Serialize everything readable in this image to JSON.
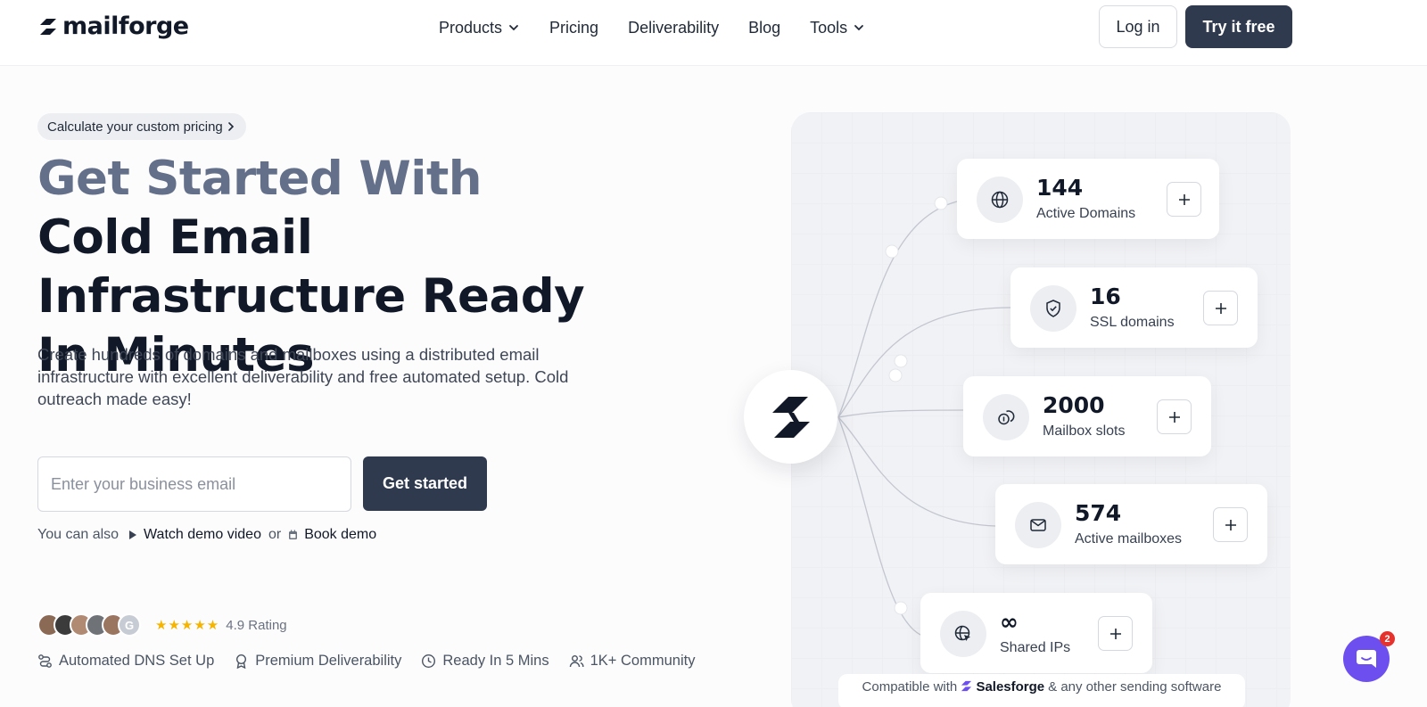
{
  "brand": {
    "name": "mailforge"
  },
  "nav": {
    "links": [
      {
        "label": "Products",
        "has_dropdown": true
      },
      {
        "label": "Pricing"
      },
      {
        "label": "Deliverability"
      },
      {
        "label": "Blog"
      },
      {
        "label": "Tools",
        "has_dropdown": true
      }
    ],
    "login_label": "Log in",
    "try_label": "Try it free"
  },
  "hero": {
    "pill_label": "Calculate your custom pricing",
    "headline_muted": "Get Started With",
    "headline_rest": "Cold Email Infrastructure Ready In Minutes",
    "subtitle": "Create hundreds of domains and mailboxes using a distributed email infrastructure with excellent deliverability and free automated setup. Cold outreach made easy!",
    "email_placeholder": "Enter your business email",
    "cta_label": "Get started",
    "also_prefix": "You can also",
    "watch_label": "Watch demo video",
    "or_text": "or",
    "book_label": "Book demo",
    "stars": "★★★★★",
    "rating_text": "4.9 Rating",
    "features": [
      {
        "label": "Automated DNS Set Up",
        "icon": "dns-route-icon"
      },
      {
        "label": "Premium Deliverability",
        "icon": "award-icon"
      },
      {
        "label": "Ready In 5 Mins",
        "icon": "clock-icon"
      },
      {
        "label": "1K+ Community",
        "icon": "users-icon"
      }
    ]
  },
  "stats": [
    {
      "value": "144",
      "label": "Active Domains",
      "icon": "globe-icon"
    },
    {
      "value": "16",
      "label": "SSL domains",
      "icon": "shield-check-icon"
    },
    {
      "value": "2000",
      "label": "Mailbox slots",
      "icon": "coins-icon"
    },
    {
      "value": "574",
      "label": "Active mailboxes",
      "icon": "mail-icon"
    },
    {
      "value": "∞",
      "label": "Shared IPs",
      "icon": "globe-pointer-icon"
    }
  ],
  "compat": {
    "prefix": "Compatible with",
    "brand": "Salesforge",
    "suffix": "& any other sending software"
  },
  "chat": {
    "unread_count": "2"
  },
  "colors": {
    "primary_dark": "#2f3a4f",
    "headline_muted": "#64708a",
    "star": "#f5b400",
    "chat_purple": "#6d4ff0",
    "badge_red": "#e5322d"
  }
}
